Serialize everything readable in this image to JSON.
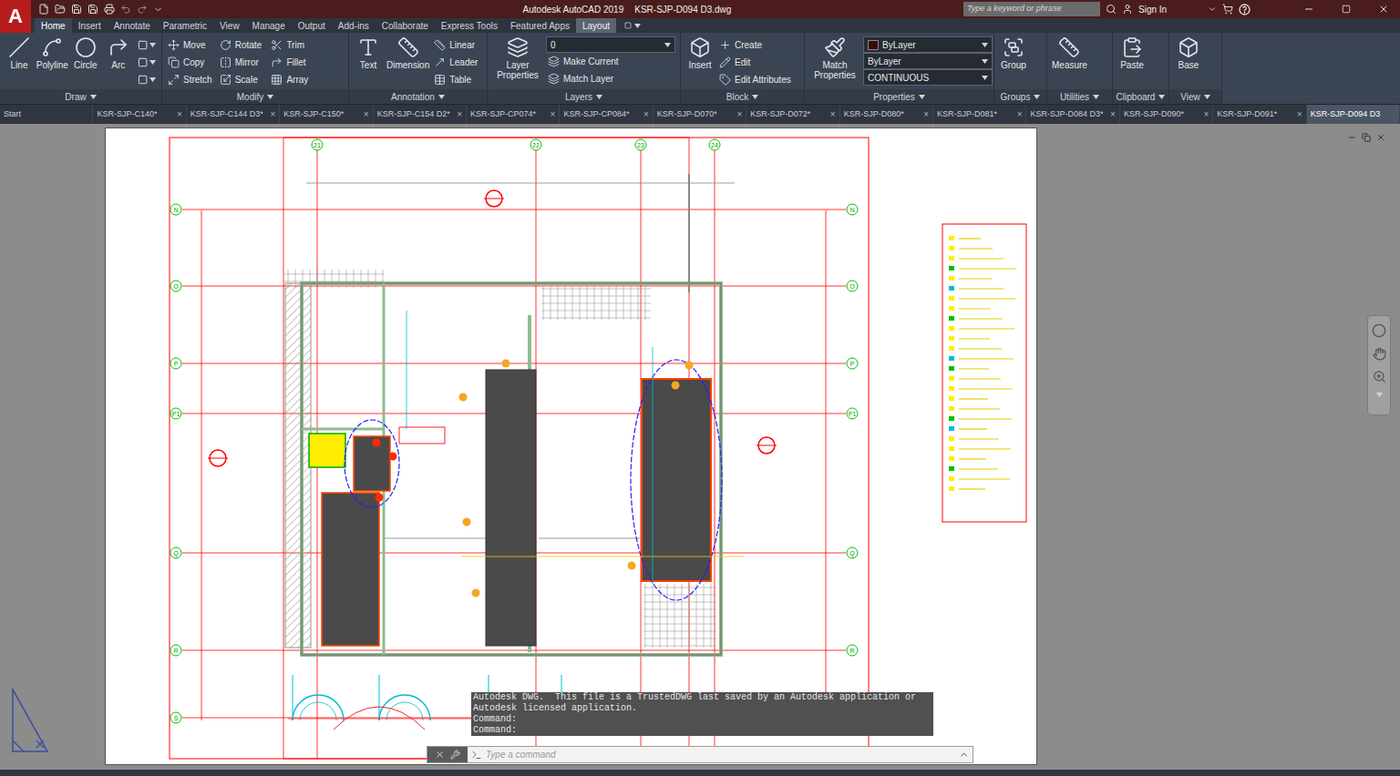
{
  "title_bar": {
    "logo": "A",
    "app": "Autodesk AutoCAD 2019",
    "file": "KSR-SJP-D094 D3.dwg",
    "search_placeholder": "Type a keyword or phrase",
    "sign_in": "Sign In"
  },
  "ribbon_tabs": [
    {
      "label": "Home",
      "selected": true,
      "contextual": false
    },
    {
      "label": "Insert",
      "selected": false,
      "contextual": false
    },
    {
      "label": "Annotate",
      "selected": false,
      "contextual": false
    },
    {
      "label": "Parametric",
      "selected": false,
      "contextual": false
    },
    {
      "label": "View",
      "selected": false,
      "contextual": false
    },
    {
      "label": "Manage",
      "selected": false,
      "contextual": false
    },
    {
      "label": "Output",
      "selected": false,
      "contextual": false
    },
    {
      "label": "Add-ins",
      "selected": false,
      "contextual": false
    },
    {
      "label": "Collaborate",
      "selected": false,
      "contextual": false
    },
    {
      "label": "Express Tools",
      "selected": false,
      "contextual": false
    },
    {
      "label": "Featured Apps",
      "selected": false,
      "contextual": false
    },
    {
      "label": "Layout",
      "selected": false,
      "contextual": true
    }
  ],
  "panels": [
    {
      "label": "Draw",
      "large": [
        {
          "label": "Line"
        },
        {
          "label": "Polyline"
        },
        {
          "label": "Circle"
        },
        {
          "label": "Arc"
        }
      ],
      "small": [
        {
          "kind": "icon",
          "label": ""
        },
        {
          "kind": "icon",
          "label": ""
        },
        {
          "kind": "icon",
          "label": ""
        }
      ]
    },
    {
      "label": "Modify",
      "large": [],
      "small": [
        {
          "kind": "button",
          "label": "Move"
        },
        {
          "kind": "button",
          "label": "Rotate"
        },
        {
          "kind": "button",
          "label": "Trim"
        },
        {
          "kind": "button",
          "label": "Copy"
        },
        {
          "kind": "button",
          "label": "Mirror"
        },
        {
          "kind": "button",
          "label": "Fillet"
        },
        {
          "kind": "button",
          "label": "Stretch"
        },
        {
          "kind": "button",
          "label": "Scale"
        },
        {
          "kind": "button",
          "label": "Array"
        }
      ]
    },
    {
      "label": "Annotation",
      "large": [
        {
          "label": "Text"
        },
        {
          "label": "Dimension"
        }
      ],
      "small": [
        {
          "kind": "button",
          "label": "Linear"
        },
        {
          "kind": "button",
          "label": "Leader"
        },
        {
          "kind": "button",
          "label": "Table"
        }
      ]
    },
    {
      "label": "Layers",
      "large": [
        {
          "label": "Layer Properties"
        }
      ],
      "small": [
        {
          "kind": "dropdown",
          "label": "0"
        },
        {
          "kind": "button",
          "label": "Make Current"
        },
        {
          "kind": "button",
          "label": "Match Layer"
        }
      ]
    },
    {
      "label": "Block",
      "large": [
        {
          "label": "Insert"
        }
      ],
      "small": [
        {
          "kind": "button",
          "label": "Create"
        },
        {
          "kind": "button",
          "label": "Edit"
        },
        {
          "kind": "button",
          "label": "Edit Attributes"
        }
      ]
    },
    {
      "label": "Properties",
      "large": [
        {
          "label": "Match Properties"
        }
      ],
      "small": [
        {
          "kind": "swatch",
          "label": "ByLayer",
          "color": "#3a0c0c"
        },
        {
          "kind": "dropdown",
          "label": "ByLayer"
        },
        {
          "kind": "dropdown",
          "label": "CONTINUOUS"
        }
      ]
    },
    {
      "label": "Groups",
      "large": [
        {
          "label": "Group"
        }
      ],
      "small": []
    },
    {
      "label": "Utilities",
      "large": [
        {
          "label": "Measure"
        }
      ],
      "small": []
    },
    {
      "label": "Clipboard",
      "large": [
        {
          "label": "Paste"
        }
      ],
      "small": []
    },
    {
      "label": "View",
      "large": [
        {
          "label": "Base"
        }
      ],
      "small": []
    }
  ],
  "doc_tabs": [
    {
      "label": "Start",
      "selected": false,
      "closable": false
    },
    {
      "label": "KSR-SJP-C140*",
      "selected": false,
      "closable": true
    },
    {
      "label": "KSR-SJP-C144 D3*",
      "selected": false,
      "closable": true
    },
    {
      "label": "KSR-SJP-C150*",
      "selected": false,
      "closable": true
    },
    {
      "label": "KSR-SJP-C154 D2*",
      "selected": false,
      "closable": true
    },
    {
      "label": "KSR-SJP-CP074*",
      "selected": false,
      "closable": true
    },
    {
      "label": "KSR-SJP-CP084*",
      "selected": false,
      "closable": true
    },
    {
      "label": "KSR-SJP-D070*",
      "selected": false,
      "closable": true
    },
    {
      "label": "KSR-SJP-D072*",
      "selected": false,
      "closable": true
    },
    {
      "label": "KSR-SJP-D080*",
      "selected": false,
      "closable": true
    },
    {
      "label": "KSR-SJP-D081*",
      "selected": false,
      "closable": true
    },
    {
      "label": "KSR-SJP-D084 D3*",
      "selected": false,
      "closable": true
    },
    {
      "label": "KSR-SJP-D090*",
      "selected": false,
      "closable": true
    },
    {
      "label": "KSR-SJP-D091*",
      "selected": false,
      "closable": true
    },
    {
      "label": "KSR-SJP-D094 D3",
      "selected": true,
      "closable": true
    }
  ],
  "close_glyph": "×",
  "drawing": {
    "grid_rows": [
      "N",
      "O",
      "P",
      "P1",
      "Q",
      "R",
      "S"
    ],
    "grid_cols": [
      "21",
      "22",
      "23",
      "24"
    ]
  },
  "command_line": {
    "history": [
      "Autodesk DWG.  This file is a TrustedDWG last saved by an Autodesk application or Autodesk licensed application.",
      "Command:",
      "Command:"
    ],
    "placeholder": "Type a command"
  }
}
